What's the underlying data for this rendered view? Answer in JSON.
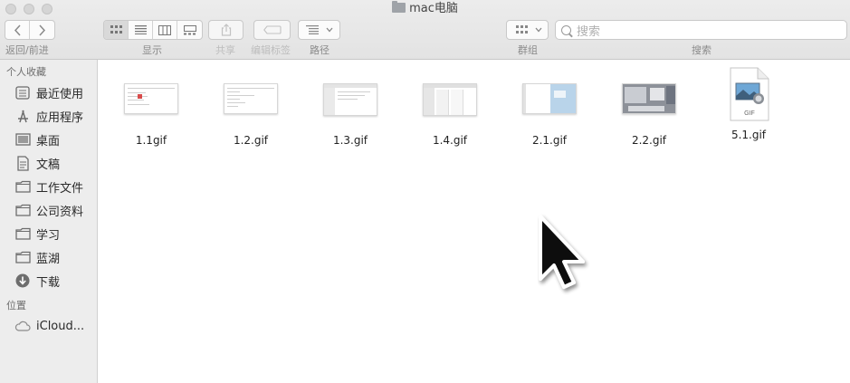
{
  "window": {
    "title": "mac电脑"
  },
  "toolbar": {
    "nav_label": "返回/前进",
    "view_label": "显示",
    "share_label": "共享",
    "tags_label": "编辑标签",
    "path_label": "路径",
    "group_label": "群组",
    "search_label": "搜索",
    "search_placeholder": "搜索"
  },
  "sidebar": {
    "favorites_header": "个人收藏",
    "favorites": [
      {
        "label": "最近使用",
        "icon": "recents-icon"
      },
      {
        "label": "应用程序",
        "icon": "applications-icon"
      },
      {
        "label": "桌面",
        "icon": "desktop-icon"
      },
      {
        "label": "文稿",
        "icon": "documents-icon"
      },
      {
        "label": "工作文件",
        "icon": "folder-icon"
      },
      {
        "label": "公司资料",
        "icon": "folder-icon"
      },
      {
        "label": "学习",
        "icon": "folder-icon"
      },
      {
        "label": "蓝湖",
        "icon": "folder-icon"
      },
      {
        "label": "下载",
        "icon": "downloads-icon"
      }
    ],
    "locations_header": "位置",
    "locations": [
      {
        "label": "iCloud...",
        "icon": "icloud-icon"
      }
    ]
  },
  "files": [
    {
      "name": "1.1gif"
    },
    {
      "name": "1.2.gif"
    },
    {
      "name": "1.3.gif"
    },
    {
      "name": "1.4.gif"
    },
    {
      "name": "2.1.gif"
    },
    {
      "name": "2.2.gif"
    },
    {
      "name": "5.1.gif",
      "badge": "GIF"
    }
  ]
}
